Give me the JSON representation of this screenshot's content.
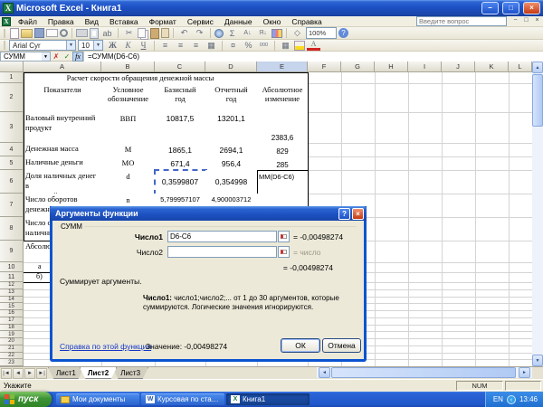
{
  "window": {
    "title": "Microsoft Excel - Книга1",
    "controls": {
      "minimize": "−",
      "maximize": "□",
      "close": "×"
    }
  },
  "icons": {
    "dropdown": "▼",
    "up": "▲",
    "down": "▼",
    "left": "◄",
    "right": "►",
    "tab_first": "|◄",
    "tab_prev": "◄",
    "tab_next": "►",
    "tab_last": "►|"
  },
  "menu": {
    "items": [
      "Файл",
      "Правка",
      "Вид",
      "Вставка",
      "Формат",
      "Сервис",
      "Данные",
      "Окно",
      "Справка"
    ],
    "question_placeholder": "Введите вопрос"
  },
  "toolbars": {
    "standard": [
      {
        "n": "new-document-icon",
        "k": "page"
      },
      {
        "n": "open-icon",
        "k": "folder"
      },
      {
        "n": "save-icon",
        "k": "floppy"
      },
      {
        "n": "mail-icon",
        "k": "mail"
      },
      {
        "n": "search-icon",
        "k": "search"
      },
      {
        "sep": true
      },
      {
        "n": "print-icon",
        "k": "print"
      },
      {
        "n": "print-preview-icon",
        "k": "preview"
      },
      {
        "n": "spelling-icon",
        "g": "ab"
      },
      {
        "sep": true
      },
      {
        "n": "cut-icon",
        "g": "✂"
      },
      {
        "n": "copy-icon",
        "k": "copy"
      },
      {
        "n": "paste-icon",
        "k": "paste"
      },
      {
        "n": "format-painter-icon",
        "k": "paint"
      },
      {
        "sep": true
      },
      {
        "n": "undo-icon",
        "g": "↶"
      },
      {
        "n": "redo-icon",
        "g": "↷"
      },
      {
        "sep": true
      },
      {
        "n": "insert-hyperlink-icon",
        "k": "globe"
      },
      {
        "n": "autosum-icon",
        "g": "Σ"
      },
      {
        "n": "sort-ascending-icon",
        "g": "А↓",
        "cls": "sort"
      },
      {
        "n": "sort-descending-icon",
        "g": "Я↓",
        "cls": "sort"
      },
      {
        "n": "chart-wizard-icon",
        "k": "chart"
      },
      {
        "sep": true
      },
      {
        "n": "drawing-icon",
        "g": "◇"
      },
      {
        "n": "zoom-combo",
        "t": "100%",
        "k": "zoom"
      },
      {
        "n": "help-icon",
        "g": "?",
        "k": "help"
      }
    ],
    "formatting": {
      "font_name": "Arial Cyr",
      "font_size": "10",
      "icons": [
        {
          "n": "bold-icon",
          "g": "Ж",
          "cls": "b"
        },
        {
          "n": "italic-icon",
          "g": "К",
          "cls": "i"
        },
        {
          "n": "underline-icon",
          "g": "Ч",
          "cls": "u"
        },
        {
          "sep": true
        },
        {
          "n": "align-left-icon",
          "g": "≡"
        },
        {
          "n": "align-center-icon",
          "g": "≡"
        },
        {
          "n": "align-right-icon",
          "g": "≡"
        },
        {
          "n": "merge-center-icon",
          "g": "▦"
        },
        {
          "sep": true
        },
        {
          "n": "currency-icon",
          "g": "¤"
        },
        {
          "n": "percent-icon",
          "g": "%"
        },
        {
          "n": "comma-style-icon",
          "g": "000",
          "cls": "tiny"
        },
        {
          "sep": true
        },
        {
          "n": "borders-icon",
          "g": "▦"
        },
        {
          "n": "fill-color-icon",
          "k": "fill"
        },
        {
          "n": "font-color-icon",
          "g": "А",
          "k": "fontcol"
        }
      ]
    }
  },
  "formula_bar": {
    "name_box": "СУММ",
    "cancel_glyph": "✗",
    "enter_glyph": "✓",
    "fx_label": "fx",
    "formula": "=СУММ(D6-C6)"
  },
  "sheet": {
    "columns": [
      "A",
      "B",
      "C",
      "D",
      "E",
      "F",
      "G",
      "H",
      "I",
      "J",
      "K",
      "L"
    ],
    "selected_column": "E",
    "visible_rows": 23,
    "title_cell": {
      "range": "A1:D1",
      "text": "Расчет скорости обращения денежной массы"
    },
    "cells": [
      {
        "cell": "E1",
        "lines": [
          ""
        ],
        "type": "empty"
      },
      {
        "cell": "A2",
        "lines": [
          "Показатели"
        ],
        "type": "header"
      },
      {
        "cell": "B2",
        "lines": [
          "Условное",
          "обозначение"
        ],
        "type": "header"
      },
      {
        "cell": "C2",
        "lines": [
          "Базисный",
          "год"
        ],
        "type": "header"
      },
      {
        "cell": "D2",
        "lines": [
          "Отчетный",
          "год"
        ],
        "type": "header"
      },
      {
        "cell": "E2",
        "lines": [
          "Абсолютное",
          "изменение"
        ],
        "type": "header"
      },
      {
        "cell": "A3",
        "lines": [
          "Валовый внутренний",
          "продукт"
        ],
        "type": "label"
      },
      {
        "cell": "B3",
        "lines": [
          "ВВП"
        ],
        "type": "sym"
      },
      {
        "cell": "C3",
        "lines": [
          "10817,5"
        ],
        "type": "num"
      },
      {
        "cell": "D3",
        "lines": [
          "13201,1"
        ],
        "type": "num"
      },
      {
        "cell": "E3",
        "lines": [
          "2383,6"
        ],
        "type": "num-bottom"
      },
      {
        "cell": "A4",
        "lines": [
          "Денежная масса"
        ],
        "type": "label"
      },
      {
        "cell": "B4",
        "lines": [
          "М"
        ],
        "type": "sym"
      },
      {
        "cell": "C4",
        "lines": [
          "1865,1"
        ],
        "type": "num-center"
      },
      {
        "cell": "D4",
        "lines": [
          "2694,1"
        ],
        "type": "num-center"
      },
      {
        "cell": "E4",
        "lines": [
          "829"
        ],
        "type": "num-bottom"
      },
      {
        "cell": "A5",
        "lines": [
          "Наличные деньги"
        ],
        "type": "label"
      },
      {
        "cell": "B5",
        "lines": [
          "МО"
        ],
        "type": "sym"
      },
      {
        "cell": "C5",
        "lines": [
          "671,4"
        ],
        "type": "num-center"
      },
      {
        "cell": "D5",
        "lines": [
          "956,4"
        ],
        "type": "num-center"
      },
      {
        "cell": "E5",
        "lines": [
          "285"
        ],
        "type": "num-bottom"
      },
      {
        "cell": "A6",
        "lines": [
          "Доля наличных денег в",
          "денежной массе"
        ],
        "type": "label"
      },
      {
        "cell": "B6",
        "lines": [
          "d"
        ],
        "type": "sym"
      },
      {
        "cell": "C6",
        "lines": [
          "0,3599807"
        ],
        "type": "num-center",
        "marquee": true
      },
      {
        "cell": "D6",
        "lines": [
          "0,354998"
        ],
        "type": "num-center"
      },
      {
        "cell": "E6",
        "lines": [
          "ММ(D6-C6)"
        ],
        "type": "formula",
        "active": true
      },
      {
        "cell": "A7",
        "lines": [
          "Число оборотов",
          "денежной массы"
        ],
        "type": "label"
      },
      {
        "cell": "B7",
        "lines": [
          "n"
        ],
        "type": "sym"
      },
      {
        "cell": "C7",
        "lines": [
          "5,799957107"
        ],
        "type": "num-small"
      },
      {
        "cell": "D7",
        "lines": [
          "4,900003712"
        ],
        "type": "num-small"
      },
      {
        "cell": "E7",
        "lines": [
          ""
        ],
        "type": "empty"
      },
      {
        "cell": "A8",
        "lines": [
          "Число об",
          "наличны"
        ],
        "type": "label"
      },
      {
        "cell": "A9",
        "lines": [
          "Абсолю"
        ],
        "type": "plain"
      },
      {
        "cell": "A10",
        "lines": [
          "а"
        ],
        "type": "plain-border",
        "indent": 16
      },
      {
        "cell": "A11",
        "lines": [
          "б)"
        ],
        "type": "plain-border",
        "indent": 14
      }
    ]
  },
  "dialog": {
    "title": "Аргументы функции",
    "help_glyph": "?",
    "close_glyph": "×",
    "function_name": "СУММ",
    "fields": [
      {
        "label": "Число1",
        "value": "D6-C6",
        "result": "= -0,00498274"
      },
      {
        "label": "Число2",
        "value": "",
        "result": "= число"
      }
    ],
    "result": "= -0,00498274",
    "description": "Суммирует аргументы.",
    "arg_name": "Число1:",
    "arg_help": "число1;число2;... от 1 до 30 аргументов, которые суммируются. Логические значения игнорируются.",
    "help_link": "Справка по этой функции",
    "value_text": "Значение: -0,00498274",
    "ok_label": "ОК",
    "cancel_label": "Отмена"
  },
  "sheet_tabs": [
    {
      "label": "Лист1",
      "active": false
    },
    {
      "label": "Лист2",
      "active": true
    },
    {
      "label": "Лист3",
      "active": false
    }
  ],
  "status_bar": {
    "left": "Укажите",
    "num": "NUM"
  },
  "taskbar": {
    "start_label": "пуск",
    "items": [
      {
        "label": "Мои документы",
        "icon": "folder",
        "active": false
      },
      {
        "label": "Курсовая по статис...",
        "icon": "word",
        "active": false
      },
      {
        "label": "Книга1",
        "icon": "excel",
        "active": true
      }
    ],
    "tray": {
      "lang": "EN",
      "time": "13:46"
    }
  }
}
